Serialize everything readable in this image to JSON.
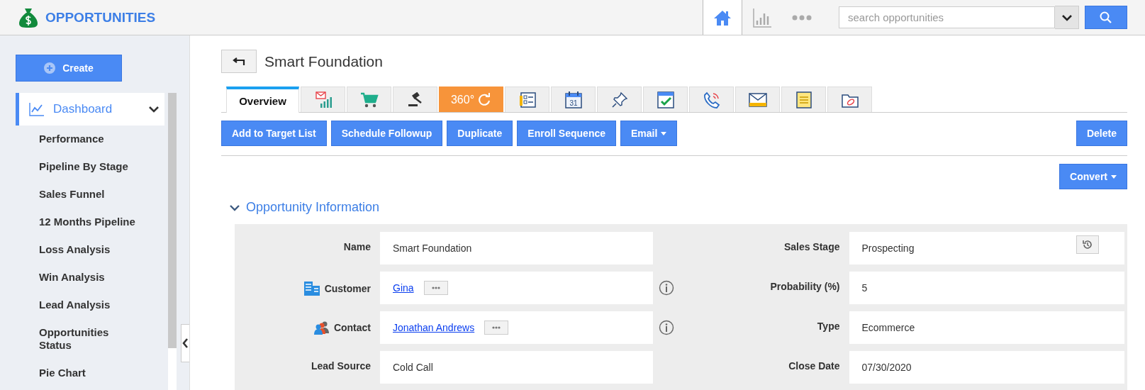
{
  "app": {
    "title": "OPPORTUNITIES"
  },
  "header_nav": [
    {
      "kind": "home",
      "selected": true
    },
    {
      "kind": "chart",
      "selected": false
    },
    {
      "kind": "more",
      "selected": false
    }
  ],
  "search": {
    "placeholder": "search opportunities"
  },
  "sidebar": {
    "create_button": "Create",
    "dashboard": {
      "label": "Dashboard",
      "expanded": true
    },
    "items": [
      {
        "label": "Performance"
      },
      {
        "label": "Pipeline By Stage"
      },
      {
        "label": "Sales Funnel"
      },
      {
        "label": "12 Months Pipeline"
      },
      {
        "label": "Loss Analysis"
      },
      {
        "label": "Win Analysis"
      },
      {
        "label": "Lead Analysis"
      },
      {
        "label": "Opportunities Status"
      },
      {
        "label": "Pie Chart"
      }
    ]
  },
  "record": {
    "title": "Smart Foundation"
  },
  "tabs": [
    {
      "kind": "label",
      "label": "Overview",
      "selected": true,
      "highlighted": false
    },
    {
      "kind": "icon",
      "selected": false,
      "highlighted": false
    },
    {
      "kind": "icon",
      "selected": false,
      "highlighted": false
    },
    {
      "kind": "icon",
      "selected": false,
      "highlighted": false
    },
    {
      "kind": "label-icon",
      "label": "360°",
      "selected": false,
      "highlighted": true
    },
    {
      "kind": "icon",
      "selected": false,
      "highlighted": false
    },
    {
      "kind": "icon",
      "selected": false,
      "highlighted": false,
      "icon_text": "31"
    },
    {
      "kind": "icon",
      "selected": false,
      "highlighted": false
    },
    {
      "kind": "icon",
      "selected": false,
      "highlighted": false
    },
    {
      "kind": "icon",
      "selected": false,
      "highlighted": false
    },
    {
      "kind": "icon",
      "selected": false,
      "highlighted": false
    },
    {
      "kind": "icon",
      "selected": false,
      "highlighted": false
    },
    {
      "kind": "icon",
      "selected": false,
      "highlighted": false
    }
  ],
  "actions": [
    {
      "label": "Add to Target List",
      "dropdown": false
    },
    {
      "label": "Schedule Followup",
      "dropdown": false
    },
    {
      "label": "Duplicate",
      "dropdown": false
    },
    {
      "label": "Enroll Sequence",
      "dropdown": false
    },
    {
      "label": "Email",
      "dropdown": true
    }
  ],
  "delete_button": "Delete",
  "convert_button": {
    "label": "Convert",
    "dropdown": true
  },
  "section": {
    "title": "Opportunity Information",
    "expanded": true,
    "left_fields": [
      {
        "label": "Name",
        "kind": "text",
        "value": "Smart Foundation"
      },
      {
        "label": "Customer",
        "kind": "link",
        "value": "Gina"
      },
      {
        "label": "Contact",
        "kind": "link",
        "value": "Jonathan Andrews"
      },
      {
        "label": "Lead Source",
        "kind": "text",
        "value": "Cold Call"
      }
    ],
    "right_fields": [
      {
        "label": "Sales Stage",
        "kind": "history",
        "value": "Prospecting"
      },
      {
        "label": "Probability (%)",
        "kind": "text",
        "value": "5"
      },
      {
        "label": "Type",
        "kind": "text",
        "value": "Ecommerce"
      },
      {
        "label": "Close Date",
        "kind": "text",
        "value": "07/30/2020"
      }
    ]
  }
}
